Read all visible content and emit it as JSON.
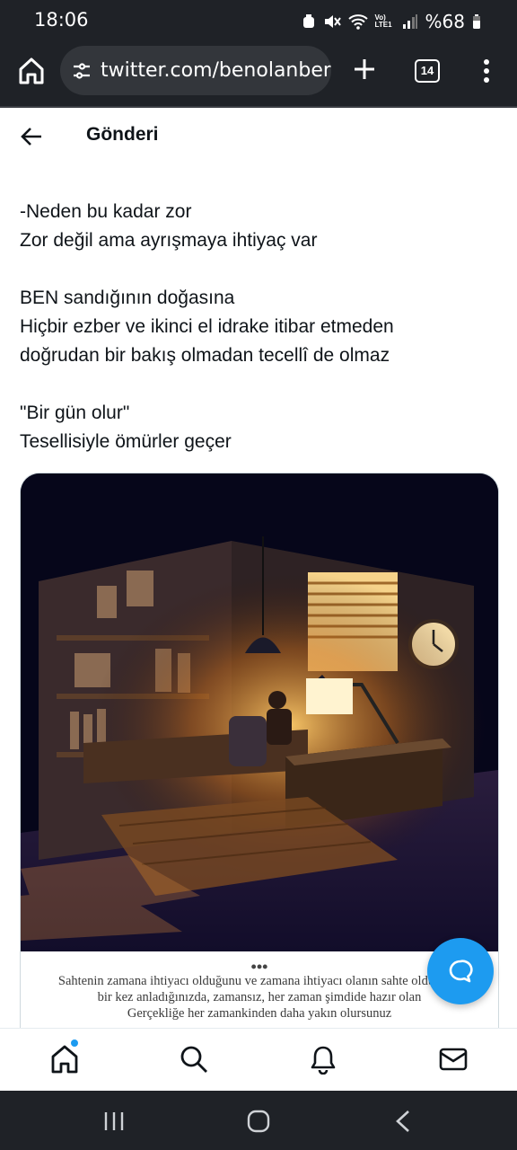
{
  "status": {
    "time": "18:06",
    "battery": "%68",
    "network": "Vo) LTE1"
  },
  "browser": {
    "url": "twitter.com/benolanben/",
    "tab_count": "14"
  },
  "header": {
    "title": "Gönderi"
  },
  "post": {
    "lines": [
      "-Neden bu kadar zor",
      "Zor değil ama ayrışmaya ihtiyaç var",
      "",
      "BEN sandığının doğasına",
      "Hiçbir ezber ve ikinci el idrake itibar etmeden",
      "doğrudan bir bakış olmadan tecellî de olmaz",
      "",
      "\"Bir gün olur\"",
      "Tesellisiyle ömürler geçer"
    ]
  },
  "media": {
    "caption_dots": "•••",
    "caption_lines": [
      "Sahtenin zamana ihtiyacı olduğunu ve zamana ihtiyacı olanın sahte olduğunu",
      "bir kez anladığınızda, zamansız, her zaman şimdide hazır olan",
      "Gerçekliğe her zamankinden daha yakın olursunuz"
    ]
  },
  "icons": {
    "home": "home-icon",
    "tune": "site-settings-icon",
    "plus": "new-tab-icon",
    "menu": "more-vert-icon",
    "back": "arrow-left-icon",
    "fab": "chat-bubble-icon",
    "search": "search-icon",
    "notifications": "bell-icon",
    "messages": "mail-icon"
  },
  "colors": {
    "accent": "#1d9bf0",
    "chrome": "#1f2227",
    "text": "#0f1419"
  }
}
